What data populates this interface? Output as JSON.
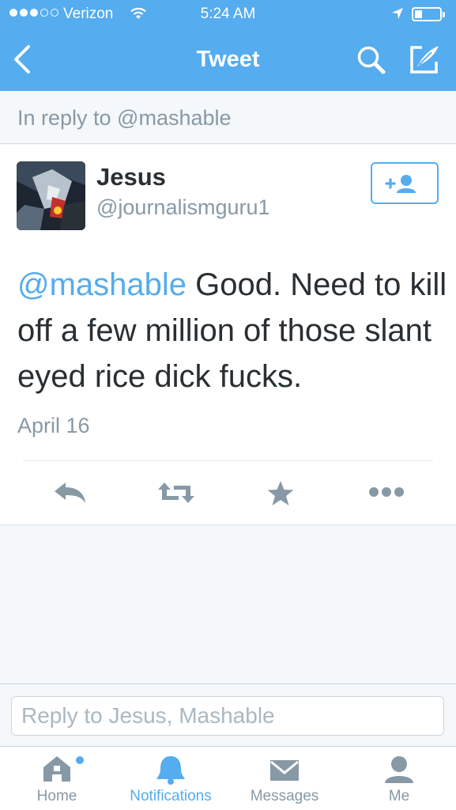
{
  "status_bar": {
    "carrier": "Verizon",
    "time": "5:24 AM",
    "battery_level": 0.3
  },
  "nav": {
    "title": "Tweet",
    "icons": [
      "back-chevron-icon",
      "search-icon",
      "compose-icon"
    ]
  },
  "reply_context": "In reply to @mashable",
  "tweet": {
    "author_name": "Jesus",
    "author_handle": "@journalismguru1",
    "mention": "@mashable",
    "text": " Good. Need to kill off a few million of those slant eyed rice dick fucks.",
    "date": "April 16",
    "actions": [
      "reply-icon",
      "retweet-icon",
      "favorite-icon",
      "more-icon"
    ]
  },
  "reply_box": {
    "placeholder": "Reply to Jesus, Mashable",
    "value": ""
  },
  "tab_bar": {
    "tabs": [
      {
        "label": "Home",
        "icon": "home-icon",
        "has_badge": true
      },
      {
        "label": "Notifications",
        "icon": "bell-icon",
        "active": true
      },
      {
        "label": "Messages",
        "icon": "envelope-icon"
      },
      {
        "label": "Me",
        "icon": "person-icon"
      }
    ]
  },
  "colors": {
    "brand": "#55acee",
    "text": "#292f33",
    "muted": "#8899a6"
  }
}
